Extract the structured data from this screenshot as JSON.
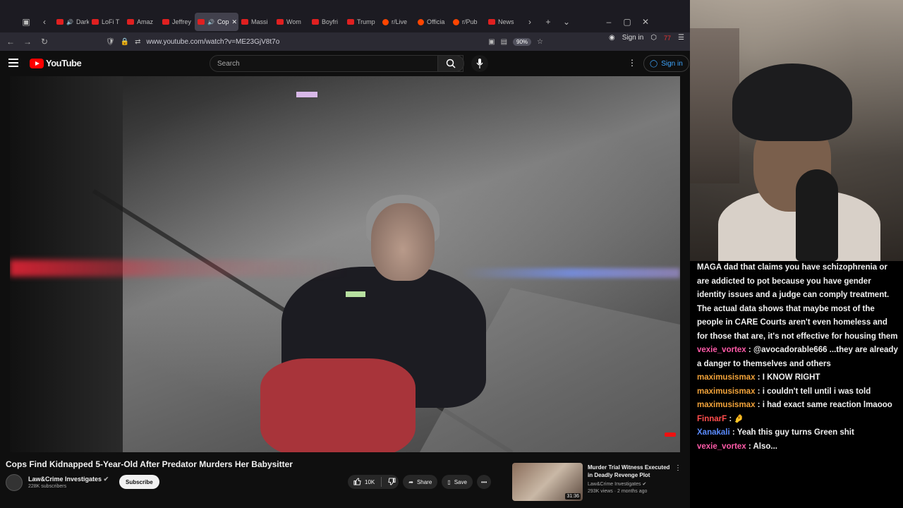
{
  "browser": {
    "tabs": [
      {
        "label": "Dark S",
        "type": "youtube"
      },
      {
        "label": "LoFi T",
        "type": "youtube"
      },
      {
        "label": "Amaz",
        "type": "youtube"
      },
      {
        "label": "Jeffrey",
        "type": "youtube"
      },
      {
        "label": "Cop",
        "type": "youtube",
        "active": true
      },
      {
        "label": "Massi",
        "type": "youtube"
      },
      {
        "label": "Wom",
        "type": "youtube"
      },
      {
        "label": "Boyfri",
        "type": "youtube"
      },
      {
        "label": "Trump",
        "type": "youtube"
      },
      {
        "label": "r/Live",
        "type": "reddit"
      },
      {
        "label": "Officia",
        "type": "reddit"
      },
      {
        "label": "r/Pub",
        "type": "reddit"
      },
      {
        "label": "News",
        "type": "youtube"
      }
    ],
    "url": "www.youtube.com/watch?v=ME23GjV8t7o",
    "zoom": "90%",
    "signin_label": "Sign in",
    "extension_badge": "77"
  },
  "youtube": {
    "logo_text": "YouTube",
    "search_placeholder": "Search",
    "signin_label": "Sign in",
    "video": {
      "title": "Cops Find Kidnapped 5-Year-Old After Predator Murders Her Babysitter",
      "channel": "Law&Crime Investigates",
      "subscribers": "228K subscribers",
      "subscribe_label": "Subscribe",
      "likes": "10K",
      "share_label": "Share",
      "save_label": "Save"
    },
    "related": {
      "title": "Murder Trial Witness Executed in Deadly Revenge Plot",
      "channel": "Law&Crime Investigates",
      "meta": "293K views · 2 months ago",
      "duration": "31:36"
    }
  },
  "chat": {
    "intro": "MAGA dad that claims you have schizophrenia or are addicted to pot because you have gender identity issues and a judge can comply treatment. The actual data shows that maybe most of the people in CARE Courts aren't even homeless and for those that are, it's not effective for housing them",
    "messages": [
      {
        "user": "vexie_vortex",
        "color": "#ff5aa8",
        "text": "@avocadorable666 ...they are already a danger to themselves and others"
      },
      {
        "user": "maximusismax",
        "color": "#f2a33a",
        "text": "I KNOW RIGHT"
      },
      {
        "user": "maximusismax",
        "color": "#f2a33a",
        "text": "i couldn't tell until i was told"
      },
      {
        "user": "maximusismax",
        "color": "#f2a33a",
        "text": "i had exact same reaction lmaooo"
      },
      {
        "user": "FinnarF",
        "color": "#ff4d4d",
        "text": "🤌"
      },
      {
        "user": "Xanakali",
        "color": "#5b8cff",
        "text": "Yeah this guy turns Green shit"
      },
      {
        "user": "vexie_vortex",
        "color": "#ff5aa8",
        "text": "Also..."
      }
    ]
  }
}
